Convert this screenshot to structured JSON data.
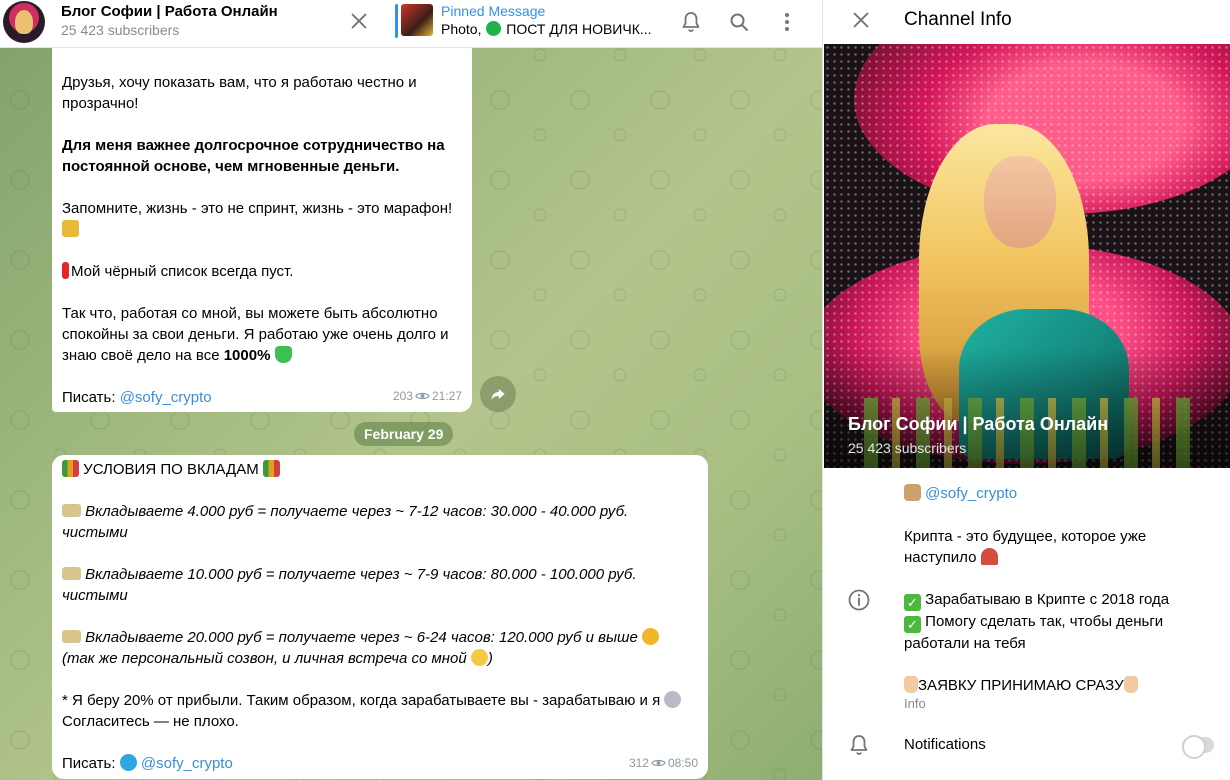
{
  "header": {
    "channel_title": "Блог Софии | Работа Онлайн",
    "subscribers": "25 423 subscribers",
    "close_icon": "close-icon",
    "pinned": {
      "title": "Pinned Message",
      "text_prefix": "Photo, ",
      "text_suffix": " ПОСТ ДЛЯ НОВИЧК..."
    }
  },
  "messages": [
    {
      "paragraphs": [
        "Друзья, хочу показать вам, что я работаю честно и прозрачно!",
        "Для меня важнее долгосрочное сотрудничество на постоянной основе, чем мгновенные деньги.",
        "Запомните, жизнь - это не спринт, жизнь - это марафон!",
        "Мой чёрный список всегда пуст.",
        "Так что, работая со мной, вы можете быть абсолютно спокойны за свои деньги. Я работаю уже очень долго и знаю своё дело на все ",
        "1000%"
      ],
      "write_label": "Писать: ",
      "write_handle": "@sofy_crypto",
      "views": "203",
      "time": "21:27"
    },
    {
      "title": " УСЛОВИЯ ПО ВКЛАДАМ ",
      "items": [
        "Вкладываете 4.000 руб  = получаете через ~ 7-12 часов: 30.000 - 40.000 руб. чистыми",
        "Вкладываете 10.000 руб  =  получаете через ~ 7-9 часов: 80.000 - 100.000 руб. чистыми",
        "Вкладываете 20.000 руб  = получаете через ~ 6-24 часов: 120.000 руб и выше ",
        "(так же персональный созвон, и личная встреча со мной "
      ],
      "closing": "* Я беру 20% от прибыли. Таким образом, когда зарабатываете вы - зарабатываю и я ",
      "closing_end": " Согласитесь — не плохо.",
      "write_label": "Писать: ",
      "write_handle": "@sofy_crypto",
      "views": "312",
      "time": "08:50"
    }
  ],
  "date_separator": "February 29",
  "info": {
    "title": "Channel Info",
    "hero_name": "Блог Софии | Работа Онлайн",
    "hero_subscribers": "25 423 subscribers",
    "link": "@sofy_crypto",
    "desc_1": "Крипта - это будущее, которое уже наступило",
    "desc_2": "Зарабатываю в Крипте с 2018 года",
    "desc_3": "Помогу сделать так, чтобы деньги работали на тебя",
    "desc_4": "ЗАЯВКУ ПРИНИМАЮ СРАЗУ",
    "caption": "Info",
    "notifications": "Notifications",
    "notifications_enabled": false
  },
  "colors": {
    "accent": "#3390ec",
    "link": "#3a8fd6",
    "bubble": "#ffffff"
  }
}
